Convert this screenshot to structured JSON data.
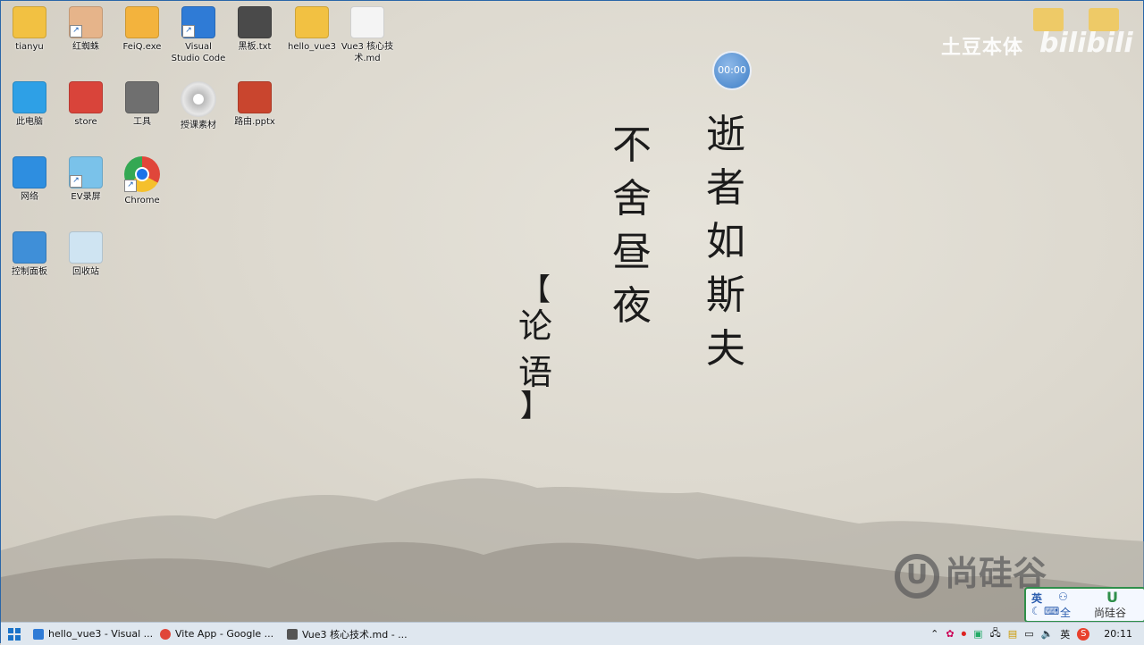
{
  "desktop_icons": [
    {
      "label": "tianyu",
      "icon": "user-folder-icon"
    },
    {
      "label": "红蜘蛛",
      "icon": "avatar-icon"
    },
    {
      "label": "FeiQ.exe",
      "icon": "feiq-icon"
    },
    {
      "label": "Visual Studio Code",
      "icon": "vscode-icon"
    },
    {
      "label": "黑板.txt",
      "icon": "sublime-icon"
    },
    {
      "label": "hello_vue3",
      "icon": "folder-icon"
    },
    {
      "label": "Vue3 核心技术.md",
      "icon": "markdown-icon"
    },
    {
      "label": "此电脑",
      "icon": "computer-icon"
    },
    {
      "label": "store",
      "icon": "store-icon"
    },
    {
      "label": "工具",
      "icon": "tools-icon"
    },
    {
      "label": "授课素材",
      "icon": "disc-icon"
    },
    {
      "label": "路由.pptx",
      "icon": "pptx-icon"
    },
    {
      "label": "网络",
      "icon": "network-icon"
    },
    {
      "label": "EV录屏",
      "icon": "ev-recorder-icon"
    },
    {
      "label": "Chrome",
      "icon": "chrome-icon"
    },
    {
      "label": "控制面板",
      "icon": "control-panel-icon"
    },
    {
      "label": "回收站",
      "icon": "recycle-bin-icon"
    }
  ],
  "wallpaper": {
    "poem_right": "逝者如斯夫",
    "poem_left": "不舍昼夜",
    "source": "论语",
    "bracket_open": "【",
    "bracket_close": "】"
  },
  "overlay": {
    "timer": "00:00",
    "watermark_text": "土豆本体",
    "bilibili": "bilibili",
    "brand": "尚硅谷"
  },
  "ime": {
    "lang": "英",
    "mode": "全",
    "brand": "尚硅谷"
  },
  "taskbar": {
    "apps": [
      {
        "label": "hello_vue3 - Visual ...",
        "color": "#2f7bd6"
      },
      {
        "label": "Vite App - Google ...",
        "color": "#e0463a"
      },
      {
        "label": "Vue3 核心技术.md - ...",
        "color": "#555555"
      }
    ],
    "tray_lang": "英",
    "clock": "20:11"
  },
  "colors": {
    "accent": "#2f7bd6",
    "taskbar": "#dfe7ef"
  }
}
